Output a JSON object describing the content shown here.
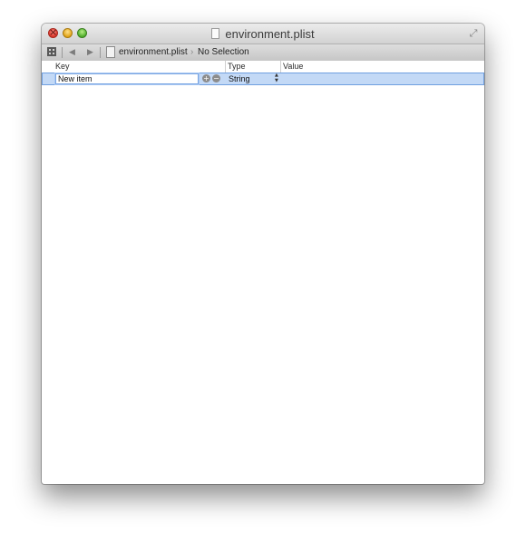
{
  "window": {
    "title": "environment.plist"
  },
  "jump_bar": {
    "back_icon": "back-arrow",
    "forward_icon": "forward-arrow",
    "file_name": "environment.plist",
    "selection": "No Selection"
  },
  "table": {
    "columns": [
      "Key",
      "Type",
      "Value"
    ],
    "rows": [
      {
        "key": "New item",
        "type": "String",
        "value": ""
      }
    ]
  },
  "colors": {
    "row_selected": "#c3d9f6",
    "row_border": "#6f9fe0",
    "close": "#d9362b",
    "minimize": "#e1a316",
    "zoom": "#4fae2b"
  }
}
